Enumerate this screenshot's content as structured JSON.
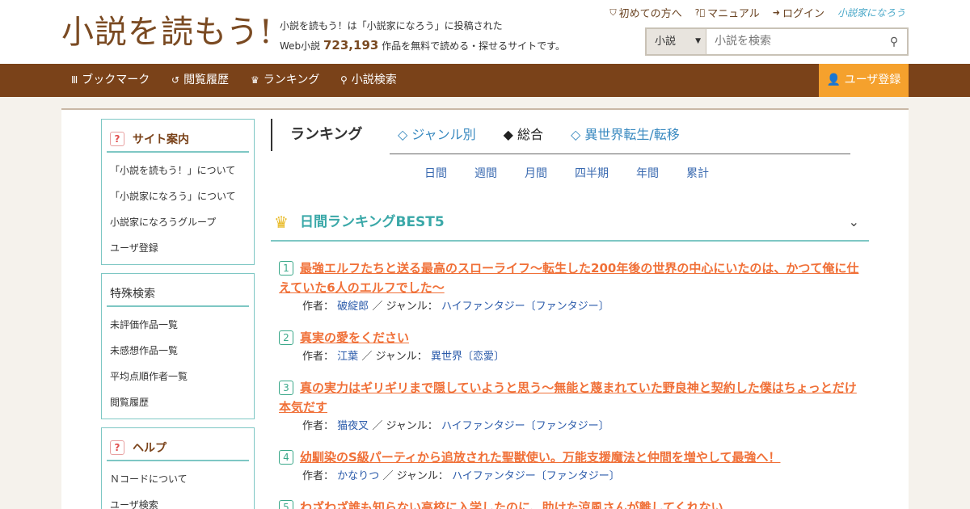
{
  "header": {
    "logo": "小説を読もう!",
    "tagline_line1": "小説を読もう！は「小説家になろう」に投稿された",
    "tagline_prefix": "Web小説",
    "tagline_count": "723,193",
    "tagline_suffix": "作品を無料で読める・探せるサイトです。",
    "links": [
      "初めての方へ",
      "マニュアル",
      "ログイン"
    ],
    "brand": "小説家になろう",
    "search_category": "小説",
    "search_placeholder": "小説を検索"
  },
  "nav": {
    "items": [
      "ブックマーク",
      "閲覧履歴",
      "ランキング",
      "小説検索"
    ],
    "register": "ユーザ登録"
  },
  "sidebar": {
    "site_guide": {
      "title": "サイト案内",
      "items": [
        "「小説を読もう！」について",
        "「小説家になろう」について",
        "小説家になろうグループ",
        "ユーザ登録"
      ]
    },
    "special_search": {
      "title": "特殊検索",
      "items": [
        "未評価作品一覧",
        "未感想作品一覧",
        "平均点順作者一覧",
        "閲覧履歴"
      ]
    },
    "help": {
      "title": "ヘルプ",
      "items": [
        "Ｎコードについて",
        "ユーザ検索"
      ]
    }
  },
  "ranking": {
    "heading": "ランキング",
    "tabs": [
      "◇ ジャンル別",
      "◆ 総合",
      "◇ 異世界転生/転移"
    ],
    "periods": [
      "日間",
      "週間",
      "月間",
      "四半期",
      "年間",
      "累計"
    ],
    "best_title": "日間ランキングBEST5",
    "author_label": "作者：",
    "genre_label": "／ ジャンル：",
    "entries": [
      {
        "rank": "1",
        "title": "最強エルフたちと送る最高のスローライフ～転生した200年後の世界の中心にいたのは、かつて俺に仕えていた6人のエルフでした～",
        "author": "破綻郎",
        "genre": "ハイファンタジー〔ファンタジー〕"
      },
      {
        "rank": "2",
        "title": "真実の愛をください",
        "author": "江葉",
        "genre": "異世界〔恋愛〕"
      },
      {
        "rank": "3",
        "title": "真の実力はギリギリまで隠していようと思う～無能と蔑まれていた野良神と契約した僕はちょっとだけ本気だす",
        "author": "猫夜叉",
        "genre": "ハイファンタジー〔ファンタジー〕"
      },
      {
        "rank": "4",
        "title": "幼馴染のS級パーティから追放された聖獣使い。万能支援魔法と仲間を増やして最強へ！",
        "author": "かなりつ",
        "genre": "ハイファンタジー〔ファンタジー〕"
      },
      {
        "rank": "5",
        "title": "わざわざ誰も知らない高校に入学したのに、助けた涼風さんが離してくれない",
        "author": "",
        "genre": ""
      }
    ]
  }
}
